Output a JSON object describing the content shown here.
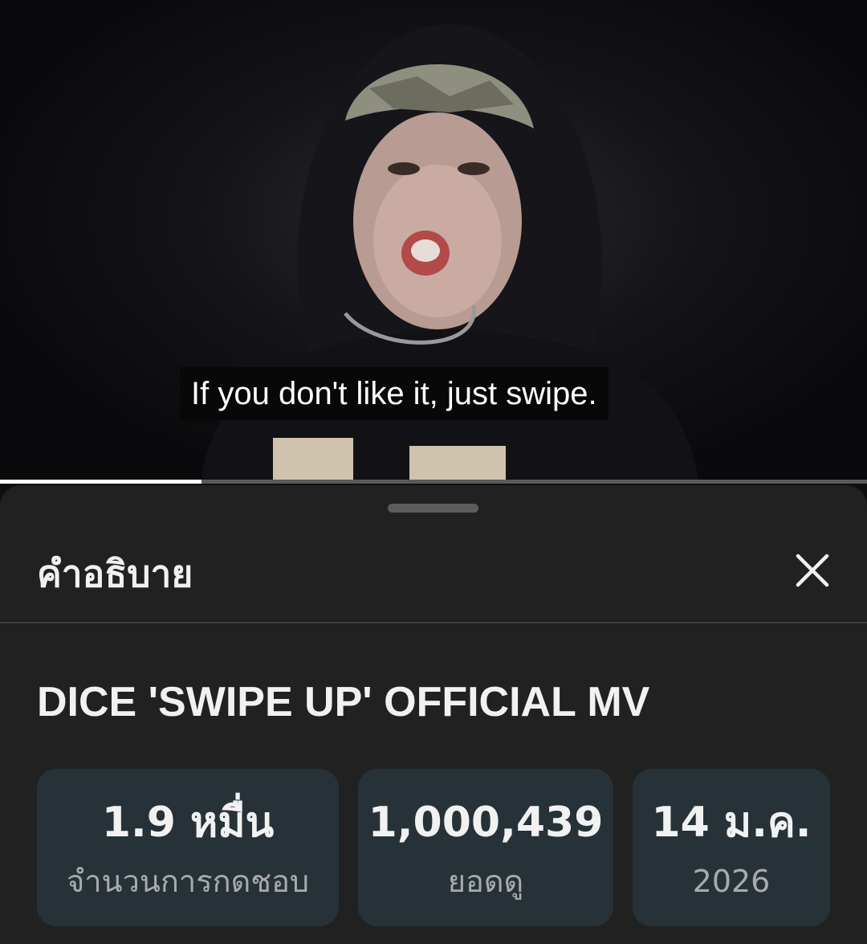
{
  "video": {
    "caption": "If you don't like it, just swipe.",
    "progress_fraction": 0.232
  },
  "panel": {
    "title": "คำอธิบาย",
    "close_icon": "close-icon"
  },
  "description": {
    "video_title": "DICE 'SWIPE UP' OFFICIAL MV",
    "stats": [
      {
        "value": "1.9 หมื่น",
        "label": "จำนวนการกดชอบ"
      },
      {
        "value": "1,000,439",
        "label": "ยอดดู"
      },
      {
        "value": "14 ม.ค.",
        "label": "2026"
      }
    ]
  },
  "colors": {
    "background": "#0f0f0f",
    "sheet": "#212121",
    "stat_card": "#263238",
    "text_primary": "#f1f1f1",
    "text_secondary": "#aaaaaa"
  }
}
